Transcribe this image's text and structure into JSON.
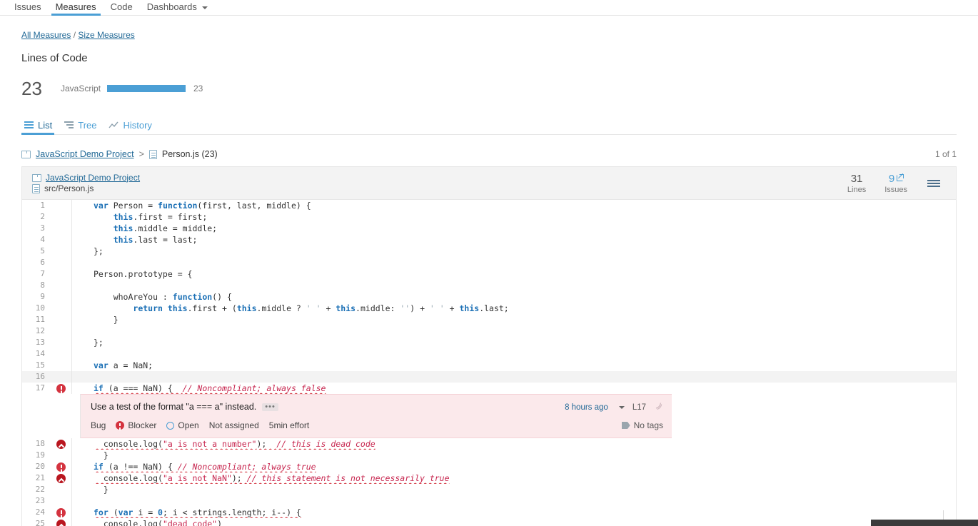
{
  "topnav": {
    "items": [
      {
        "label": "Issues",
        "active": false
      },
      {
        "label": "Measures",
        "active": true
      },
      {
        "label": "Code",
        "active": false
      },
      {
        "label": "Dashboards",
        "active": false,
        "caret": true
      }
    ]
  },
  "breadcrumb": {
    "all_measures": "All Measures",
    "separator": "/",
    "current": "Size Measures"
  },
  "metric": {
    "title": "Lines of Code",
    "total": "23",
    "language": "JavaScript",
    "bar_value": "23",
    "bar_percent": 100,
    "bar_color": "#4b9fd5"
  },
  "viewtabs": [
    {
      "label": "List",
      "icon": "list-icon",
      "active": true
    },
    {
      "label": "Tree",
      "icon": "tree-icon",
      "active": false
    },
    {
      "label": "History",
      "icon": "history-chart-icon",
      "active": false
    }
  ],
  "file_breadcrumb": {
    "project": "JavaScript Demo Project",
    "arrow": ">",
    "file": "Person.js (23)",
    "count_of": "1 of 1"
  },
  "source_header": {
    "project": "JavaScript Demo Project",
    "path": "src/Person.js",
    "measures": [
      {
        "value": "31",
        "label": "Lines",
        "link": false
      },
      {
        "value": "9",
        "label": "Issues",
        "link": true
      }
    ]
  },
  "code_lines": [
    {
      "n": "1",
      "severity": null,
      "highlight": false,
      "html": "<span class=\"kb\">var</span> Person = <span class=\"kb\">function</span>(first, last, middle) {"
    },
    {
      "n": "2",
      "severity": null,
      "highlight": false,
      "html": "    <span class=\"kb\">this</span>.first = first;"
    },
    {
      "n": "3",
      "severity": null,
      "highlight": false,
      "html": "    <span class=\"kb\">this</span>.middle = middle;"
    },
    {
      "n": "4",
      "severity": null,
      "highlight": false,
      "html": "    <span class=\"kb\">this</span>.last = last;"
    },
    {
      "n": "5",
      "severity": null,
      "highlight": false,
      "html": "};"
    },
    {
      "n": "6",
      "severity": null,
      "highlight": false,
      "html": ""
    },
    {
      "n": "7",
      "severity": null,
      "highlight": false,
      "html": "Person.prototype = {"
    },
    {
      "n": "8",
      "severity": null,
      "highlight": false,
      "html": ""
    },
    {
      "n": "9",
      "severity": null,
      "highlight": false,
      "html": "    whoAreYou : <span class=\"kb\">function</span>() {"
    },
    {
      "n": "10",
      "severity": null,
      "highlight": false,
      "html": "        <span class=\"kb\">return</span> <span class=\"kb\">this</span>.first + (<span class=\"kb\">this</span>.middle ? <span class=\"s\">' '</span> + <span class=\"kb\">this</span>.middle: <span class=\"s\">''</span>) + <span class=\"s\">' '</span> + <span class=\"kb\">this</span>.last;"
    },
    {
      "n": "11",
      "severity": null,
      "highlight": false,
      "html": "    }"
    },
    {
      "n": "12",
      "severity": null,
      "highlight": false,
      "html": ""
    },
    {
      "n": "13",
      "severity": null,
      "highlight": false,
      "html": "};"
    },
    {
      "n": "14",
      "severity": null,
      "highlight": false,
      "html": ""
    },
    {
      "n": "15",
      "severity": null,
      "highlight": false,
      "html": "<span class=\"kb\">var</span> a = NaN;"
    },
    {
      "n": "16",
      "severity": null,
      "highlight": true,
      "html": ""
    },
    {
      "n": "17",
      "severity": "blocker",
      "highlight": false,
      "html": "<span class=\"u\"><span class=\"kb\">if</span> (a === NaN) {  <span class=\"c\">// Noncompliant; always false</span></span>"
    },
    {
      "n": "18",
      "severity": "critical",
      "highlight": false,
      "html": "<span class=\"u\">  console.log(<span class=\"sr\">\"a is not a number\"</span>);  <span class=\"c\">// this is dead code</span></span>"
    },
    {
      "n": "19",
      "severity": null,
      "highlight": false,
      "html": "  }"
    },
    {
      "n": "20",
      "severity": "blocker",
      "highlight": false,
      "html": "<span class=\"u\"><span class=\"kb\">if</span> (a !== NaN) { <span class=\"c\">// Noncompliant; always true</span></span>"
    },
    {
      "n": "21",
      "severity": "critical",
      "highlight": false,
      "html": "<span class=\"u\">  console.log(<span class=\"sr\">\"a is not NaN\"</span>); <span class=\"c\">// this statement is not necessarily true</span></span>"
    },
    {
      "n": "22",
      "severity": null,
      "highlight": false,
      "html": "  }"
    },
    {
      "n": "23",
      "severity": null,
      "highlight": false,
      "html": ""
    },
    {
      "n": "24",
      "severity": "blocker",
      "highlight": false,
      "html": "<span class=\"u\"><span class=\"kb\">for</span> (<span class=\"kb\">var</span> i = <span class=\"kb\">0</span>; i &lt; strings.length; i--) {</span>"
    },
    {
      "n": "25",
      "severity": "critical",
      "highlight": false,
      "html": "<span class=\"u\">  console.log(<span class=\"sr\">\"dead code\"</span>)</span>"
    }
  ],
  "issue": {
    "after_line": "17",
    "message": "Use a test of the format \"a === a\" instead.",
    "ellipsis": "•••",
    "type": "Bug",
    "severity": "Blocker",
    "status": "Open",
    "assignee": "Not assigned",
    "effort": "5min effort",
    "date": "8 hours ago",
    "line_ref": "L17",
    "rule_icon": "sonarqube-mark-icon",
    "tags": "No tags"
  }
}
